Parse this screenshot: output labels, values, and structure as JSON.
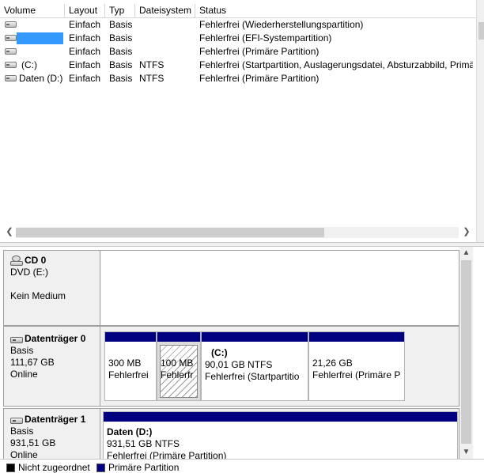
{
  "columns": [
    "Volume",
    "Layout",
    "Typ",
    "Dateisystem",
    "Status"
  ],
  "volumes": [
    {
      "name": "",
      "layout": "Einfach",
      "type": "Basis",
      "fs": "",
      "status": "Fehlerfrei (Wiederherstellungspartition)"
    },
    {
      "name": "",
      "layout": "Einfach",
      "type": "Basis",
      "fs": "",
      "status": "Fehlerfrei (EFI-Systempartition)"
    },
    {
      "name": "",
      "layout": "Einfach",
      "type": "Basis",
      "fs": "",
      "status": "Fehlerfrei (Primäre Partition)"
    },
    {
      "name": "(C:)",
      "layout": "Einfach",
      "type": "Basis",
      "fs": "NTFS",
      "status": "Fehlerfrei (Startpartition, Auslagerungsdatei, Absturzabbild, Primä"
    },
    {
      "name": "Daten (D:)",
      "layout": "Einfach",
      "type": "Basis",
      "fs": "NTFS",
      "status": "Fehlerfrei (Primäre Partition)"
    }
  ],
  "cd0": {
    "name": "CD 0",
    "device": "DVD (E:)",
    "media": "Kein Medium"
  },
  "disk0": {
    "name": "Datenträger 0",
    "type": "Basis",
    "size": "111,67 GB",
    "state": "Online",
    "partitions": [
      {
        "name": "",
        "size": "300 MB",
        "status": "Fehlerfrei"
      },
      {
        "name": "",
        "size": "100 MB",
        "status": "Fehlerfr"
      },
      {
        "name": "(C:)",
        "size": "90,01 GB NTFS",
        "status": "Fehlerfrei (Startpartitio"
      },
      {
        "name": "",
        "size": "21,26 GB",
        "status": "Fehlerfrei (Primäre P"
      }
    ]
  },
  "disk1": {
    "name": "Datenträger 1",
    "type": "Basis",
    "size": "931,51 GB",
    "state": "Online",
    "partitions": [
      {
        "name": "Daten  (D:)",
        "size": "931,51 GB NTFS",
        "status": "Fehlerfrei (Primäre Partition)"
      }
    ]
  },
  "legend": [
    {
      "label": "Nicht zugeordnet",
      "color": "#000000"
    },
    {
      "label": "Primäre Partition",
      "color": "#000080"
    }
  ],
  "icons": {
    "volume": "drive-icon",
    "cd": "cd-drive-icon",
    "disk": "disk-icon"
  },
  "colors": {
    "primary_partition": "#000080",
    "selection": "#3399ff"
  }
}
